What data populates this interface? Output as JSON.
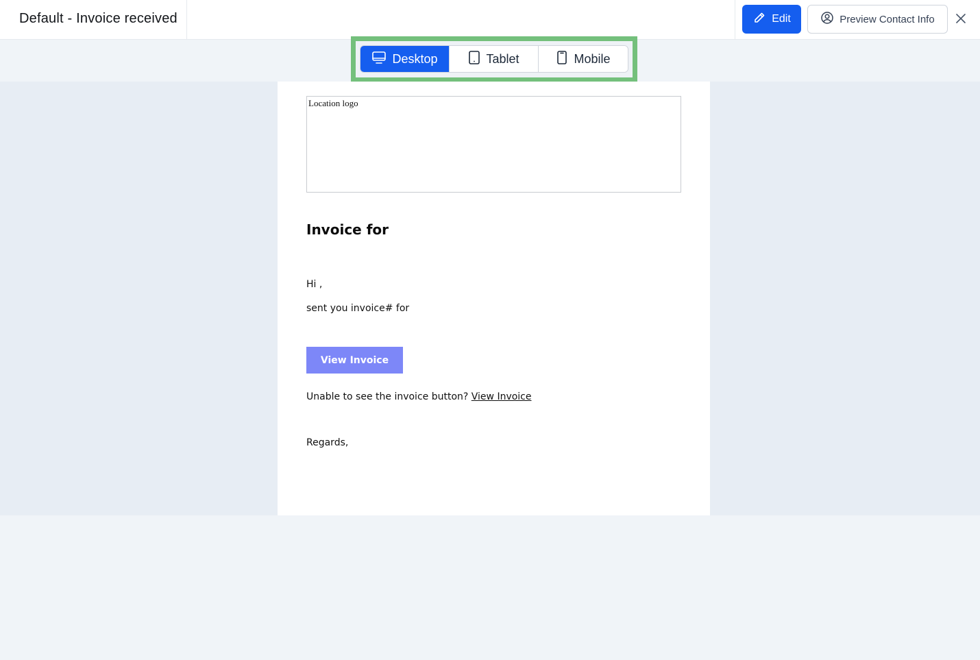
{
  "header": {
    "title": "Default - Invoice received",
    "edit_label": "Edit",
    "preview_label": "Preview Contact Info"
  },
  "devices": [
    {
      "label": "Desktop",
      "icon": "monitor-icon",
      "active": true
    },
    {
      "label": "Tablet",
      "icon": "tablet-icon",
      "active": false
    },
    {
      "label": "Mobile",
      "icon": "mobile-icon",
      "active": false
    }
  ],
  "email": {
    "logo_alt": "Location logo",
    "heading": "Invoice for",
    "greeting": "Hi ,",
    "body": "sent you invoice# for",
    "button_label": "View Invoice",
    "fallback_text": "Unable to see the invoice button?",
    "fallback_link": "View Invoice",
    "signoff": "Regards,"
  },
  "colors": {
    "accent": "#155eef",
    "cta": "#7d87f8",
    "highlight": "#74c07c",
    "canvas": "#e7edf4"
  }
}
